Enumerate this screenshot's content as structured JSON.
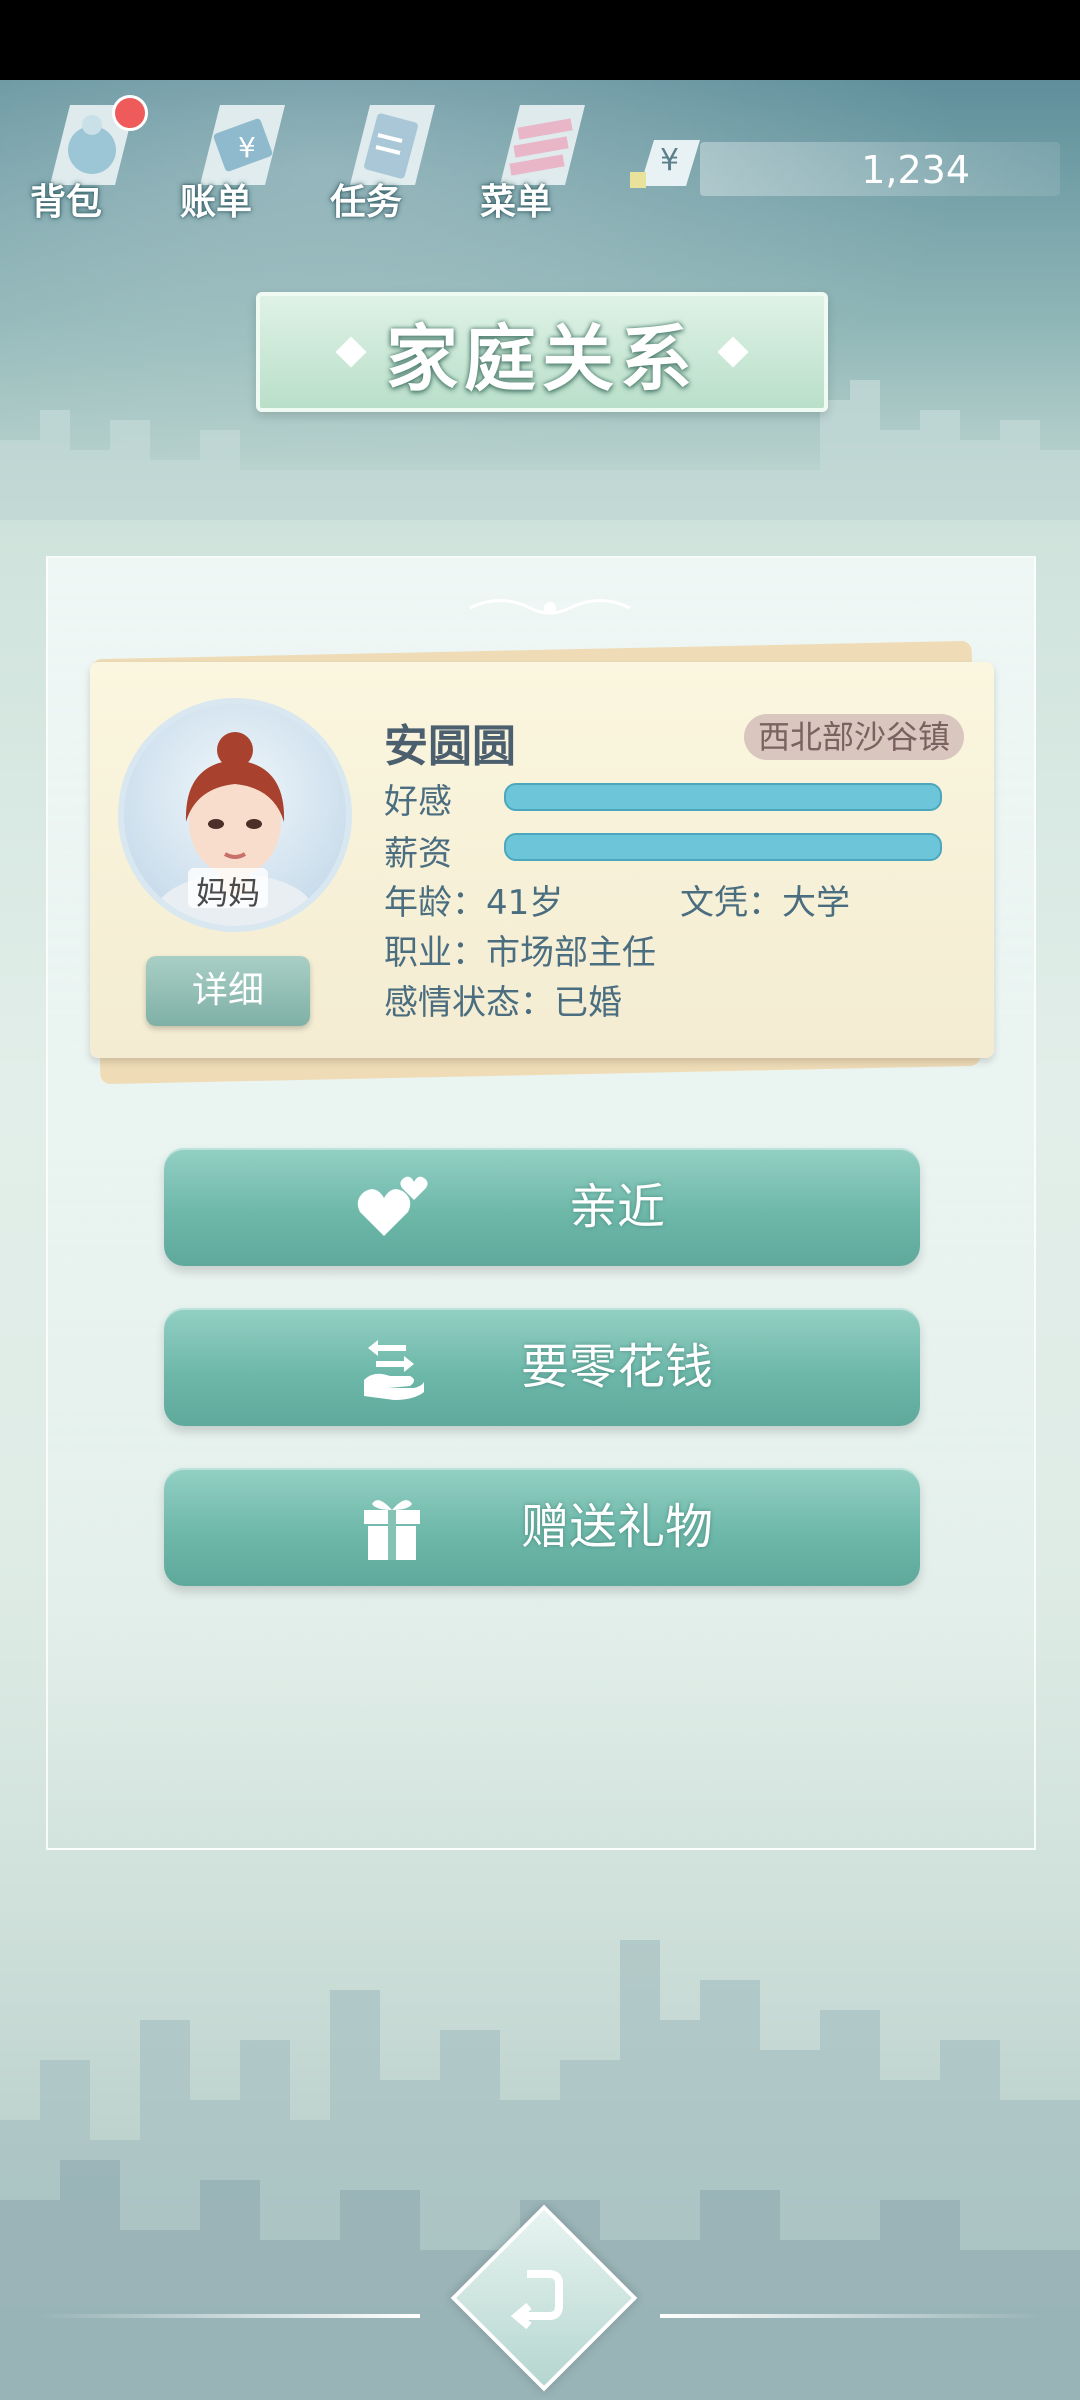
{
  "topnav": {
    "items": [
      {
        "label": "背包",
        "icon": "bag-icon",
        "badge": true
      },
      {
        "label": "账单",
        "icon": "bill-icon",
        "badge": false
      },
      {
        "label": "任务",
        "icon": "task-icon",
        "badge": false
      },
      {
        "label": "菜单",
        "icon": "menu-icon",
        "badge": false
      }
    ]
  },
  "currency": {
    "symbol": "¥",
    "value": "1,234"
  },
  "page": {
    "title": "家庭关系"
  },
  "profile": {
    "name": "安圆圆",
    "relation": "妈妈",
    "location": "西北部沙谷镇",
    "affection_label": "好感",
    "affection_level": 1.0,
    "salary_label": "薪资",
    "salary_level": 1.0,
    "age": "年龄：41岁",
    "education": "文凭：大学",
    "job": "职业：市场部主任",
    "relationship": "感情状态：已婚",
    "detail_label": "详细"
  },
  "actions": [
    {
      "label": "亲近",
      "icon": "hearts-icon"
    },
    {
      "label": "要零花钱",
      "icon": "money-exchange-icon"
    },
    {
      "label": "赠送礼物",
      "icon": "gift-icon"
    }
  ],
  "colors": {
    "accent": "#6eb8aa",
    "bar": "#6cc5d8",
    "badge": "#ef5b5b"
  }
}
